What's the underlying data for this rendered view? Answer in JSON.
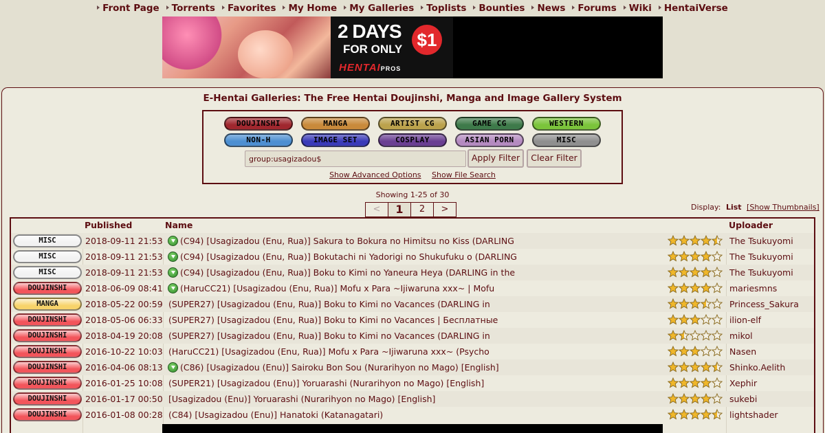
{
  "nav": [
    "Front Page",
    "Torrents",
    "Favorites",
    "My Home",
    "My Galleries",
    "Toplists",
    "Bounties",
    "News",
    "Forums",
    "Wiki",
    "HentaiVerse"
  ],
  "ad": {
    "days": "2 DAYS",
    "only": "FOR ONLY",
    "price": "$1",
    "brand": "HENTAI",
    "brand_suffix": "PROS"
  },
  "site_title": "E-Hentai Galleries: The Free Hentai Doujinshi, Manga and Image Gallery System",
  "categories": [
    {
      "label": "DOUJINSHI",
      "color": "#A0272E"
    },
    {
      "label": "MANGA",
      "color": "#C98A3B"
    },
    {
      "label": "ARTIST CG",
      "color": "#BBA24C"
    },
    {
      "label": "GAME CG",
      "color": "#3E7A4A"
    },
    {
      "label": "WESTERN",
      "color": "#7BC43B"
    },
    {
      "label": "NON-H",
      "color": "#4D8FD1"
    },
    {
      "label": "IMAGE SET",
      "color": "#3A3BB8"
    },
    {
      "label": "COSPLAY",
      "color": "#6A3F92"
    },
    {
      "label": "ASIAN PORN",
      "color": "#B48AC0"
    },
    {
      "label": "MISC",
      "color": "#8F8F8F"
    }
  ],
  "search": {
    "value": "group:usagizadou$",
    "apply": "Apply Filter",
    "clear": "Clear Filter",
    "advanced": "Show Advanced Options",
    "file_search": "Show File Search"
  },
  "showing": "Showing 1-25 of 30",
  "pager": [
    "<",
    "1",
    "2",
    ">"
  ],
  "display": {
    "label": "Display:",
    "list": "List",
    "thumbs": "[Show Thumbnails]"
  },
  "table": {
    "headers": {
      "published": "Published",
      "name": "Name",
      "uploader": "Uploader"
    },
    "rows": [
      {
        "cat": "MISC",
        "date": "2018-09-11 21:53",
        "dl": true,
        "name": "(C94) [Usagizadou (Enu, Rua)] Sakura to Bokura no Himitsu no Kiss (DARLING",
        "rating": 4.5,
        "uploader": "The Tsukuyomi"
      },
      {
        "cat": "MISC",
        "date": "2018-09-11 21:53",
        "dl": true,
        "name": "(C94) [Usagizadou (Enu, Rua)] Bokutachi ni Yadorigi no Shukufuku o (DARLING",
        "rating": 4,
        "uploader": "The Tsukuyomi"
      },
      {
        "cat": "MISC",
        "date": "2018-09-11 21:53",
        "dl": true,
        "name": "(C94) [Usagizadou (Enu, Rua)] Boku to Kimi no Yaneura Heya (DARLING in the",
        "rating": 4,
        "uploader": "The Tsukuyomi"
      },
      {
        "cat": "DOUJINSHI",
        "date": "2018-06-09 08:41",
        "dl": true,
        "name": "(HaruCC21) [Usagizadou (Enu, Rua)] Mofu x Para ~Ijiwaruna xxx~ | Mofu",
        "rating": 4,
        "uploader": "mariesmns"
      },
      {
        "cat": "MANGA",
        "date": "2018-05-22 00:59",
        "dl": false,
        "name": "(SUPER27) [Usagizadou (Enu, Rua)] Boku to Kimi no Vacances (DARLING in",
        "rating": 3.5,
        "uploader": "Princess_Sakura"
      },
      {
        "cat": "DOUJINSHI",
        "date": "2018-05-06 06:33",
        "dl": false,
        "name": "(SUPER27) [Usagizadou (Enu, Rua)] Boku to Kimi no Vacances | Бесплатные",
        "rating": 3,
        "uploader": "ilion-elf"
      },
      {
        "cat": "DOUJINSHI",
        "date": "2018-04-19 20:08",
        "dl": false,
        "name": "(SUPER27) [Usagizadou (Enu, Rua)] Boku to Kimi no Vacances (DARLING in",
        "rating": 1.5,
        "uploader": "mikol"
      },
      {
        "cat": "DOUJINSHI",
        "date": "2016-10-22 10:03",
        "dl": false,
        "name": "(HaruCC21) [Usagizadou (Enu, Rua)] Mofu x Para ~Ijiwaruna xxx~ (Psycho",
        "rating": 3,
        "uploader": "Nasen"
      },
      {
        "cat": "DOUJINSHI",
        "date": "2016-04-06 08:13",
        "dl": true,
        "name": "(C86) [Usagizadou (Enu)] Sairoku Bon Sou (Nurarihyon no Mago) [English]",
        "rating": 4.5,
        "uploader": "Shinko.Aelith"
      },
      {
        "cat": "DOUJINSHI",
        "date": "2016-01-25 10:08",
        "dl": false,
        "name": "(SUPER21) [Usagizadou (Enu)] Yoruarashi (Nurarihyon no Mago) [English]",
        "rating": 4,
        "uploader": "Xephir"
      },
      {
        "cat": "DOUJINSHI",
        "date": "2016-01-17 00:50",
        "dl": false,
        "name": "[Usagizadou (Enu)] Yoruarashi (Nurarihyon no Mago) [English]",
        "rating": 4,
        "uploader": "sukebi"
      },
      {
        "cat": "DOUJINSHI",
        "date": "2016-01-08 00:28",
        "dl": false,
        "name": "(C84) [Usagizadou (Enu)] Hanatoki (Katanagatari)",
        "rating": 4.5,
        "uploader": "lightshader"
      }
    ]
  },
  "row_cat_colors": {
    "MISC": "#F2F2F2",
    "DOUJINSHI": "#F2555B",
    "MANGA": "#F7D36A"
  }
}
